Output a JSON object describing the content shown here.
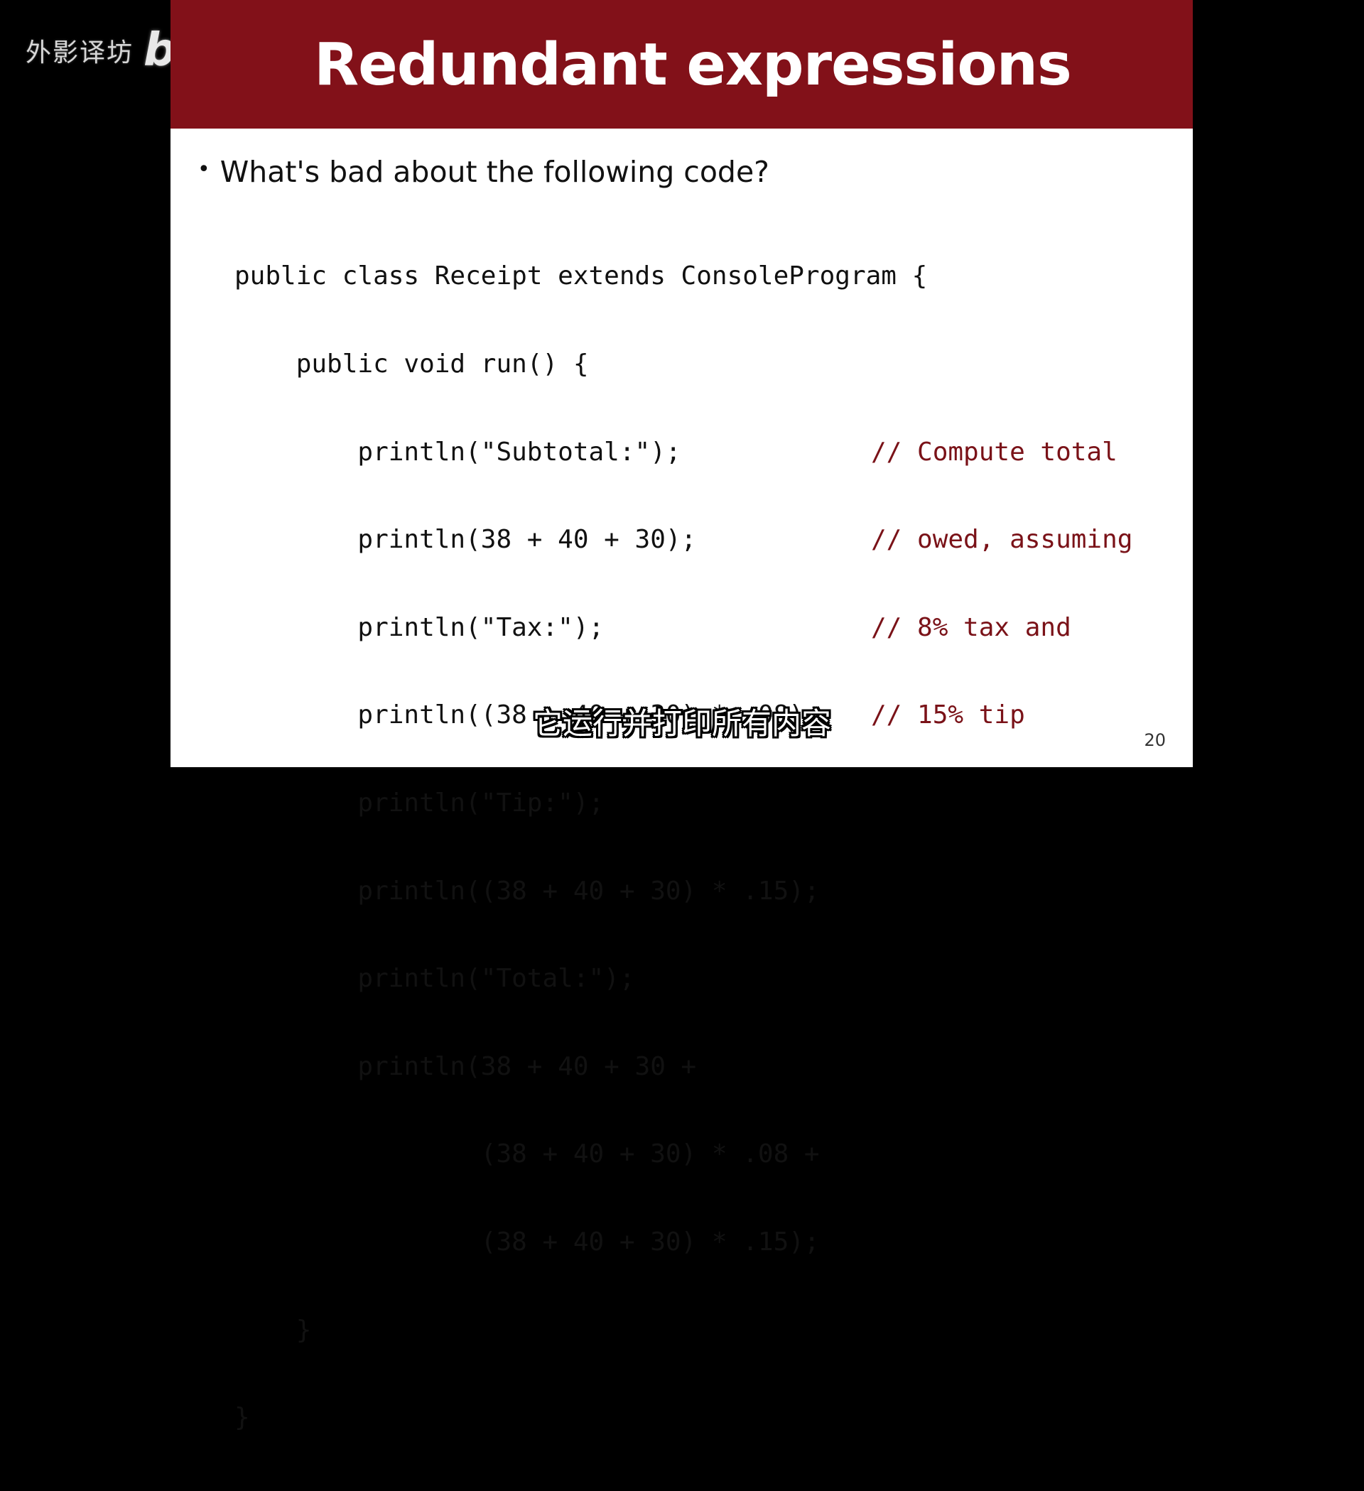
{
  "watermark": {
    "text": "外影译坊",
    "logo": "bilibili"
  },
  "slide": {
    "title": "Redundant expressions",
    "bullet": "What's bad about the following code?",
    "code_lines": [
      "public class Receipt extends ConsoleProgram {",
      "    public void run() {",
      "        println(\"Subtotal:\");",
      "        println(38 + 40 + 30);",
      "        println(\"Tax:\");",
      "        println((38 + 40 + 30) * .08);",
      "        println(\"Tip:\");",
      "        println((38 + 40 + 30) * .15);",
      "        println(\"Total:\");",
      "        println(38 + 40 + 30 +",
      "                (38 + 40 + 30) * .08 +",
      "                (38 + 40 + 30) * .15);",
      "    }",
      "}"
    ],
    "comment_lines": [
      "",
      "",
      "// Compute total",
      "// owed, assuming",
      "// 8% tax and",
      "// 15% tip"
    ],
    "page_number": "20"
  },
  "subtitle": "它运行并打印所有内容",
  "colors": {
    "header_bg": "#821119",
    "slide_bg": "#ffffff",
    "frame_bg": "#000000",
    "comment": "#7a1218"
  }
}
